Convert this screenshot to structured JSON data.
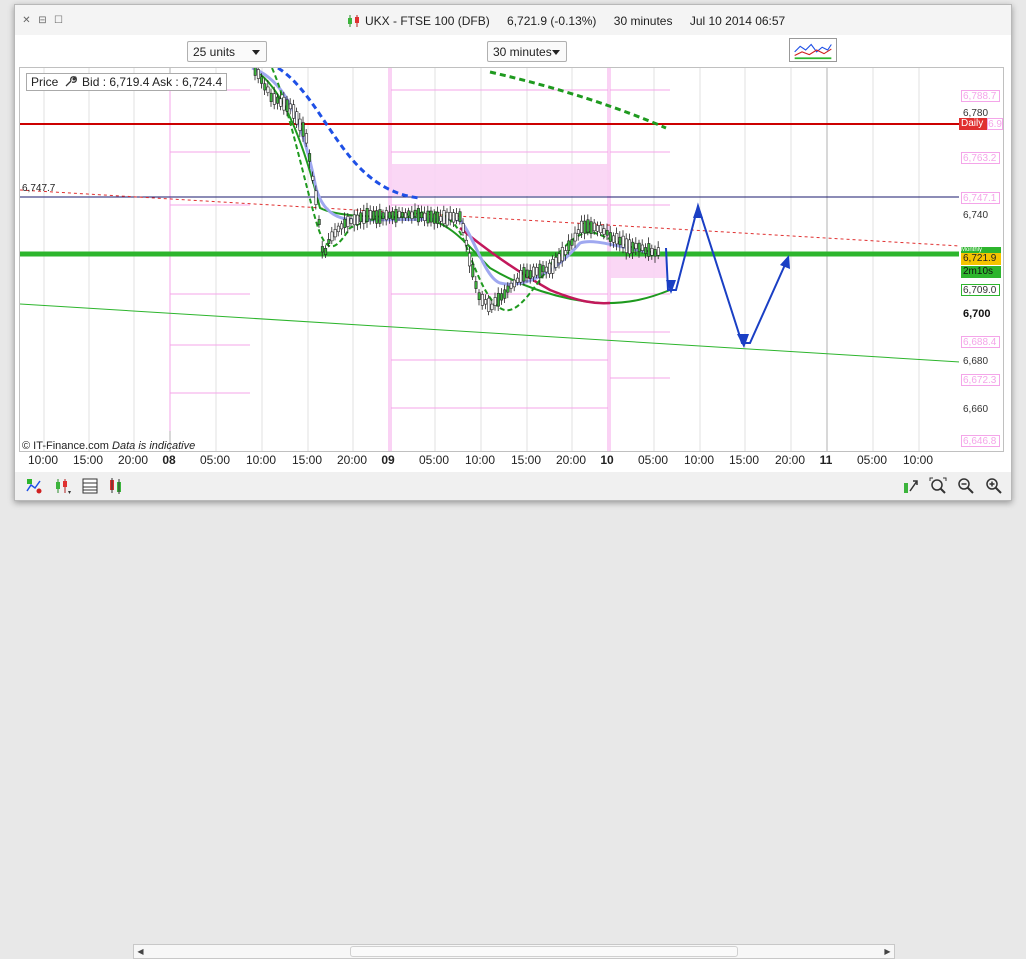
{
  "window": {
    "title_symbol": "UKX - FTSE 100 (DFB)",
    "title_price": "6,721.9 (-0.13%)",
    "title_interval": "30 minutes",
    "title_datetime": "Jul 10 2014 06:57"
  },
  "toolbar_top": {
    "units_select": "25 units",
    "interval_select": "30 minutes"
  },
  "price_panel": {
    "label": "Price",
    "bid_ask": "Bid : 6,719.4 Ask : 6,724.4"
  },
  "chart_labels": {
    "left_level": "6,747.7",
    "copyright": "© IT-Finance.com",
    "disclaimer": "Data is indicative"
  },
  "price_scale": {
    "ticks": [
      "6,780",
      "6,740",
      "6,700",
      "6,680",
      "6,660"
    ],
    "boxes": [
      "6,788.7",
      "6,763.2",
      "6,747.1",
      "6,709.0",
      "6,688.4",
      "6,672.3",
      "6,646.8"
    ],
    "daily_label": "Daily",
    "daily_value": "6,776.9",
    "monthly_label": "Monthly",
    "current_price": "6,721.9",
    "countdown": "2m10s"
  },
  "time_axis": {
    "labels": [
      "10:00",
      "15:00",
      "20:00",
      "08",
      "05:00",
      "10:00",
      "15:00",
      "20:00",
      "09",
      "05:00",
      "10:00",
      "15:00",
      "20:00",
      "10",
      "05:00",
      "10:00",
      "15:00",
      "20:00",
      "11",
      "05:00",
      "10:00"
    ]
  },
  "colors": {
    "pink": "#f4a5e9",
    "green": "#2db52d",
    "daily_red": "#cc0000",
    "blue_arrow": "#1a3fc4",
    "ma_blue": "#1e50e6",
    "ma_green_dashed": "#1f9a1f"
  }
}
